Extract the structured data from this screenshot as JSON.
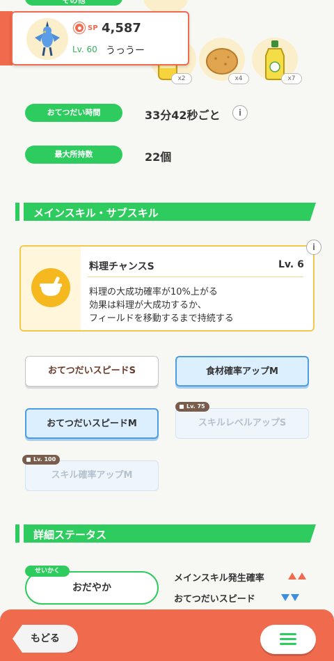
{
  "top": {
    "partial_label": "その他",
    "sp_label": "SP",
    "sp_value": "4,587",
    "level": "Lv. 60",
    "nickname": "うっうー",
    "ingredients": [
      {
        "icon": "honey-jar-icon",
        "qty": "x2"
      },
      {
        "icon": "potato-icon",
        "qty": "x4"
      },
      {
        "icon": "oil-bottle-icon",
        "qty": "x7"
      }
    ]
  },
  "stats": {
    "help_time_label": "おてつだい時間",
    "help_time_value": "33分42秒ごと",
    "max_hold_label": "最大所持数",
    "max_hold_value": "22個",
    "info_glyph": "i"
  },
  "skills_section": {
    "title": "メインスキル・サブスキル",
    "main_skill": {
      "name": "料理チャンスS",
      "level": "Lv. 6",
      "desc": [
        "料理の大成功確率が10%上がる",
        "効果は料理が大成功するか、",
        "フィールドを移動するまで持続する"
      ]
    },
    "sub_skills": [
      {
        "label": "おてつだいスピードS",
        "style": "white"
      },
      {
        "label": "食材確率アップM",
        "style": "blue"
      },
      {
        "label": "おてつだいスピードM",
        "style": "blue"
      },
      {
        "label": "スキルレベルアップS",
        "style": "locked",
        "lock": "Lv. 75"
      },
      {
        "label": "スキル確率アップM",
        "style": "locked",
        "lock": "Lv. 100"
      }
    ]
  },
  "detail_section": {
    "title": "詳細ステータス",
    "nature_badge": "せいかく",
    "nature_value": "おだやか",
    "up_effect": "メインスキル発生確率",
    "down_effect": "おてつだいスピード"
  },
  "nav": {
    "back_label": "もどる"
  },
  "colors": {
    "accent_green": "#2ecc5f",
    "accent_orange": "#f06a4d",
    "accent_blue": "#3b8fe0",
    "skill_yellow": "#f5c84a"
  }
}
